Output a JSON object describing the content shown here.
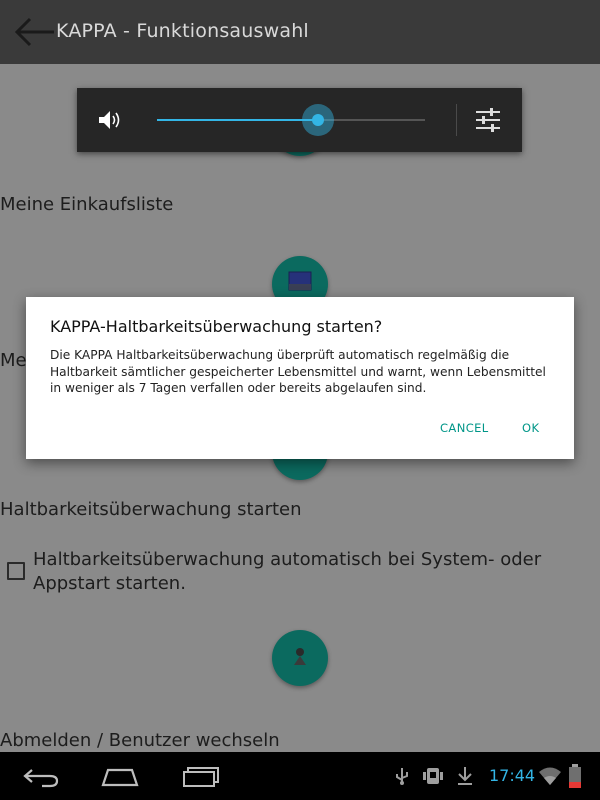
{
  "app": {
    "title": "KAPPA - Funktionsauswahl"
  },
  "menu": {
    "shopping_list": "Meine Einkaufsliste",
    "partial_label": "Me",
    "monitor_start": "Haltbarkeitsüberwachung starten",
    "auto_start": "Haltbarkeitsüberwachung automatisch bei System- oder Appstart starten.",
    "auto_start_checked": false,
    "logout": "Abmelden / Benutzer wechseln"
  },
  "volume": {
    "level": 0.6
  },
  "dialog": {
    "title": "KAPPA-Haltbarkeitsüberwachung starten?",
    "message": "Die KAPPA Haltbarkeitsüberwachung überprüft automatisch regelmäßig die Haltbarkeit sämtlicher gespeicherter Lebensmittel und warnt, wenn Lebensmittel in weniger als 7 Tagen verfallen oder bereits abgelaufen sind.",
    "cancel": "CANCEL",
    "ok": "OK"
  },
  "status": {
    "time": "17:44"
  },
  "colors": {
    "accent": "#33b5e5",
    "fab": "#0b6a5f",
    "dialog_button": "#009688"
  },
  "icons": [
    "back-arrow-icon",
    "speaker-icon",
    "equalizer-icon",
    "nav-back-icon",
    "nav-home-icon",
    "nav-recents-icon",
    "usb-icon",
    "android-debug-icon",
    "download-icon",
    "wifi-icon",
    "battery-icon"
  ]
}
